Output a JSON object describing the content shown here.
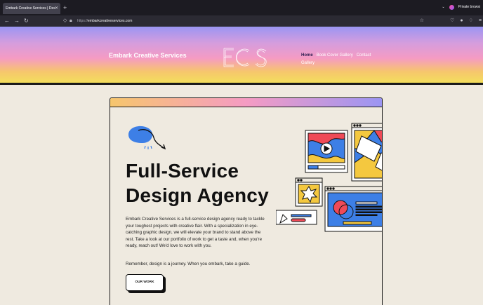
{
  "browser": {
    "tab_title": "Embark Creative Services | Des",
    "tab_close": "✕",
    "new_tab": "+",
    "private_label": "Private browsi",
    "url_prefix": "https://",
    "url_host": "embarkcreativeservices.com",
    "back_icon": "arrow-left",
    "forward_icon": "arrow-right",
    "reload_icon": "reload"
  },
  "header": {
    "site_title": "Embark Creative Services",
    "logo_text": "ECS",
    "menu": [
      {
        "label": "Home",
        "active": true
      },
      {
        "label": "Book Cover Gallery",
        "active": false
      },
      {
        "label": "Contact",
        "active": false
      },
      {
        "label": "Gallery",
        "active": false
      }
    ]
  },
  "main": {
    "headline_line1": "Full-Service",
    "headline_line2": "Design Agency",
    "body": "Embark Creative Services is a full-service design agency ready to tackle your toughest projects with creative flair. With a specialization in eye-catching graphic design, we will elevate your brand to stand above the rest. Take a look at our portfolio of work to get a taste and, when you're ready, reach out! We'd love to work with you.",
    "tagline": "Remember, design is a journey. When you embark, take a guide.",
    "cta_label": "OUR WORK"
  },
  "colors": {
    "hero_top": "#9b95f3",
    "hero_bottom": "#f3e15a",
    "page_bg": "#efeae0",
    "accent_blue": "#3d7fe6",
    "accent_red": "#ef4a57",
    "accent_yellow": "#f4c83f"
  }
}
